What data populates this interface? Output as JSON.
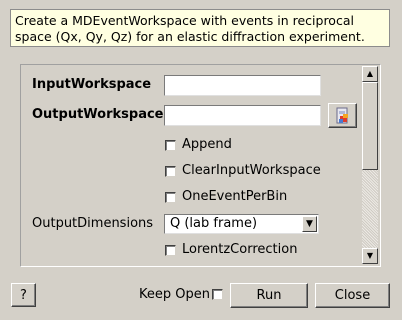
{
  "description": "Create a MDEventWorkspace with events in reciprocal space (Qx, Qy, Qz) for an elastic diffraction experiment.",
  "properties": {
    "input_workspace_label": "InputWorkspace",
    "input_workspace_value": "",
    "output_workspace_label": "OutputWorkspace",
    "output_workspace_value": "",
    "append_label": "Append",
    "clear_input_label": "ClearInputWorkspace",
    "one_event_label": "OneEventPerBin",
    "output_dimensions_label": "OutputDimensions",
    "output_dimensions_value": "Q (lab frame)",
    "lorentz_label": "LorentzCorrection"
  },
  "footer": {
    "help_label": "?",
    "keep_open_label": "Keep Open",
    "run_label": "Run",
    "close_label": "Close"
  },
  "icons": {
    "browse": "workspace-browse-icon"
  }
}
